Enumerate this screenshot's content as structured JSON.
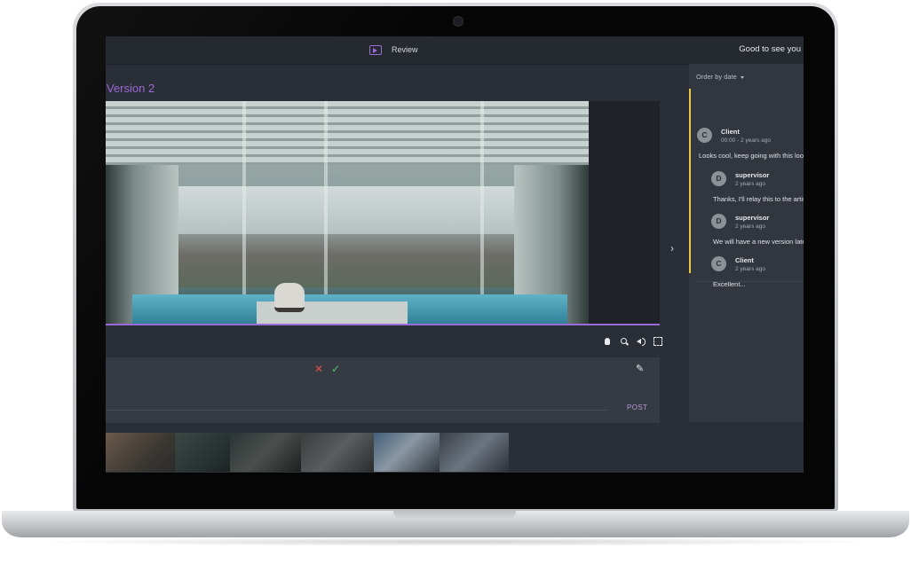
{
  "header": {
    "review_icon": "play-square-icon",
    "review_label": "Review",
    "greeting": "Good to see you"
  },
  "version": {
    "title": "Version 2"
  },
  "player": {
    "side_toggle_icon": "chevron-right-icon",
    "side_toggle": "›",
    "controls": [
      "hand-icon",
      "zoom-icon",
      "volume-icon",
      "fullscreen-icon"
    ]
  },
  "annotation": {
    "cancel_icon": "close-icon",
    "cancel_glyph": "✕",
    "confirm_icon": "check-icon",
    "confirm_glyph": "✓",
    "pencil_icon": "pencil-icon",
    "pencil_glyph": "✎",
    "post_label": "POST"
  },
  "comments": {
    "order_label": "Order by date",
    "thread_color": "#e6c84c",
    "items": [
      {
        "initial": "C",
        "author": "Client",
        "time": "00:00 - 2 years ago",
        "text": "Looks cool, keep going with this look"
      },
      {
        "initial": "D",
        "author": "supervisor",
        "time": "2 years ago",
        "text": "Thanks, I'll relay this to the artist"
      },
      {
        "initial": "D",
        "author": "supervisor",
        "time": "2 years ago",
        "text": "We will have a new version later"
      },
      {
        "initial": "C",
        "author": "Client",
        "time": "2 years ago",
        "text": "Excellent..."
      }
    ]
  },
  "colors": {
    "accent": "#9b6bd6",
    "cancel": "#e0514e",
    "confirm": "#4fc37c",
    "background": "#2a2e36"
  }
}
